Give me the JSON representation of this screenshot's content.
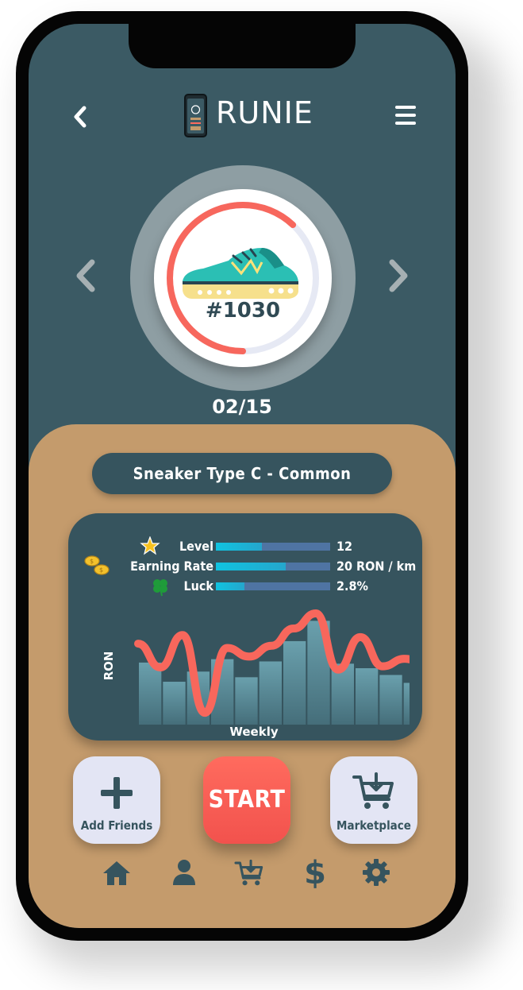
{
  "app": {
    "title": "RUNIE"
  },
  "sneaker": {
    "id": "#1030",
    "counter": "02/15",
    "type_label": "Sneaker Type C - Common",
    "durability_fraction": 0.62
  },
  "stats": [
    {
      "label": "Level",
      "icon": "star-icon",
      "value": "12",
      "fill": 0.4
    },
    {
      "label": "Earning Rate",
      "icon": "coins-icon",
      "value": "20 RON / km",
      "fill": 0.61
    },
    {
      "label": "Luck",
      "icon": "clover-icon",
      "value": "2.8%",
      "fill": 0.25
    }
  ],
  "chart_data": {
    "type": "line",
    "xlabel": "Weekly",
    "ylabel": "RON",
    "bars": [
      0.55,
      0.38,
      0.47,
      0.58,
      0.42,
      0.56,
      0.74,
      0.92,
      0.54,
      0.5,
      0.44,
      0.37
    ],
    "line": [
      0.72,
      0.5,
      0.8,
      0.08,
      0.68,
      0.6,
      0.7,
      0.86,
      1.0,
      0.48,
      0.78,
      0.51,
      0.58,
      0.52
    ]
  },
  "actions": {
    "add_friends": "Add Friends",
    "start": "START",
    "marketplace": "Marketplace"
  },
  "nav": [
    {
      "name": "home",
      "icon": "home-icon"
    },
    {
      "name": "profile",
      "icon": "user-icon"
    },
    {
      "name": "cart",
      "icon": "cart-icon"
    },
    {
      "name": "wallet",
      "icon": "dollar-icon"
    },
    {
      "name": "settings",
      "icon": "gear-icon"
    }
  ],
  "colors": {
    "screen_bg": "#3b5a64",
    "panel_bg": "#c49b6c",
    "accent": "#ff6b5e",
    "card_bg": "#36545e"
  }
}
